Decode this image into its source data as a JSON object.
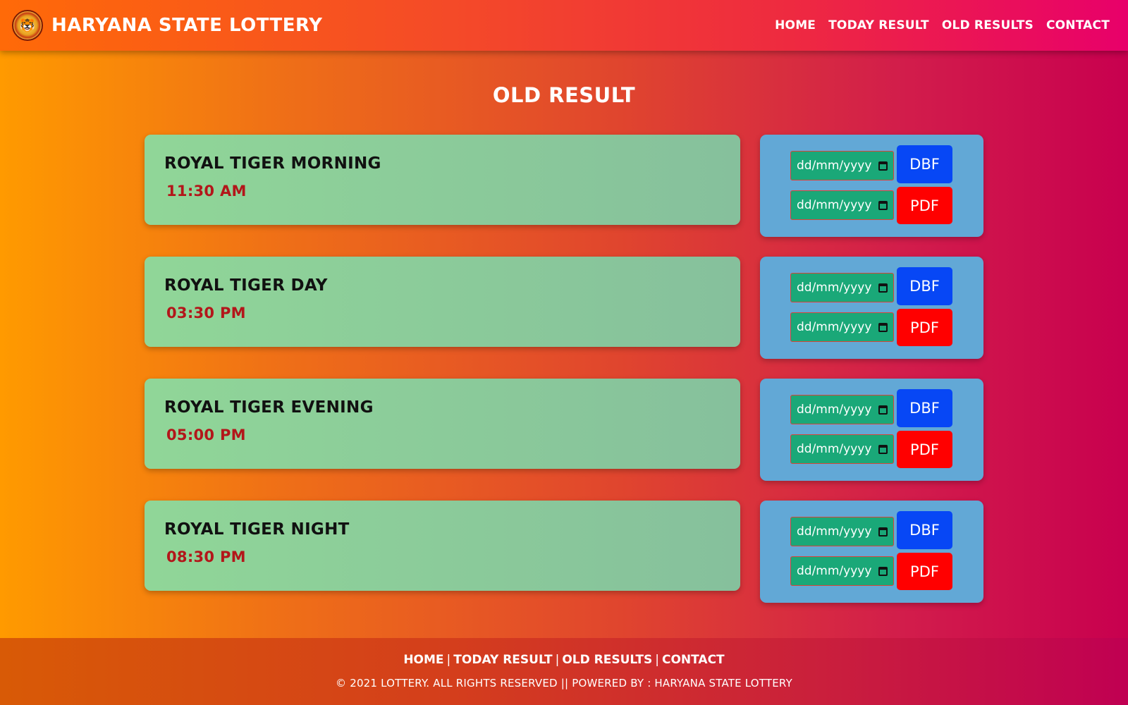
{
  "header": {
    "brand_title": "HARYANA STATE LOTTERY",
    "logo_icon": "tiger-emblem-icon",
    "nav": [
      "HOME",
      "TODAY RESULT",
      "OLD RESULTS",
      "CONTACT"
    ]
  },
  "main": {
    "title": "OLD RESULT",
    "rows": [
      {
        "name": "ROYAL TIGER MORNING",
        "time": "11:30 AM",
        "date_placeholder_1": "dd/mm/yyyy",
        "date_placeholder_2": "dd/mm/yyyy",
        "dbf_label": "DBF",
        "pdf_label": "PDF"
      },
      {
        "name": "ROYAL TIGER DAY",
        "time": "03:30 PM",
        "date_placeholder_1": "dd/mm/yyyy",
        "date_placeholder_2": "dd/mm/yyyy",
        "dbf_label": "DBF",
        "pdf_label": "PDF"
      },
      {
        "name": "ROYAL TIGER EVENING",
        "time": "05:00 PM",
        "date_placeholder_1": "dd/mm/yyyy",
        "date_placeholder_2": "dd/mm/yyyy",
        "dbf_label": "DBF",
        "pdf_label": "PDF"
      },
      {
        "name": "ROYAL TIGER NIGHT",
        "time": "08:30 PM",
        "date_placeholder_1": "dd/mm/yyyy",
        "date_placeholder_2": "dd/mm/yyyy",
        "dbf_label": "DBF",
        "pdf_label": "PDF"
      }
    ]
  },
  "footer": {
    "links": [
      "HOME",
      "TODAY RESULT",
      "OLD RESULTS",
      "CONTACT"
    ],
    "separator": "|",
    "copyright": "© 2021 LOTTERY. ALL RIGHTS RESERVED || POWERED BY : HARYANA STATE LOTTERY"
  },
  "colors": {
    "dbf_button": "#0747f5",
    "pdf_button": "#ff0000",
    "date_input": "#1aa878",
    "action_card": "#62a8d6",
    "time_text": "#b3161a"
  }
}
